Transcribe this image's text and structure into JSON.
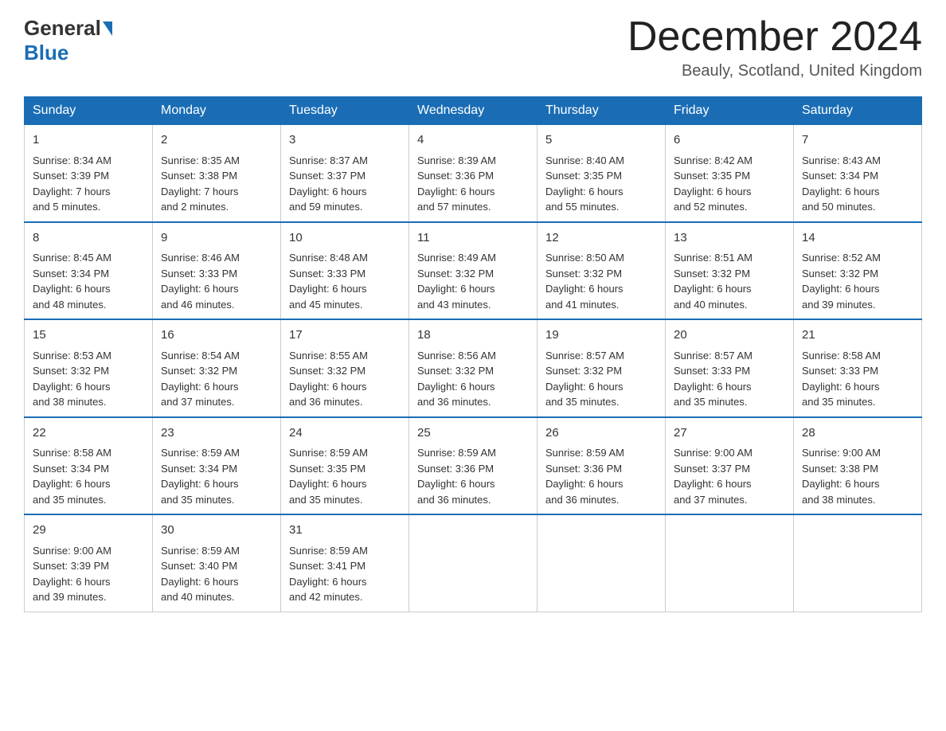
{
  "header": {
    "logo_general": "General",
    "logo_blue": "Blue",
    "month_title": "December 2024",
    "subtitle": "Beauly, Scotland, United Kingdom"
  },
  "days_of_week": [
    "Sunday",
    "Monday",
    "Tuesday",
    "Wednesday",
    "Thursday",
    "Friday",
    "Saturday"
  ],
  "weeks": [
    [
      {
        "day": "1",
        "sunrise": "8:34 AM",
        "sunset": "3:39 PM",
        "daylight": "7 hours and 5 minutes."
      },
      {
        "day": "2",
        "sunrise": "8:35 AM",
        "sunset": "3:38 PM",
        "daylight": "7 hours and 2 minutes."
      },
      {
        "day": "3",
        "sunrise": "8:37 AM",
        "sunset": "3:37 PM",
        "daylight": "6 hours and 59 minutes."
      },
      {
        "day": "4",
        "sunrise": "8:39 AM",
        "sunset": "3:36 PM",
        "daylight": "6 hours and 57 minutes."
      },
      {
        "day": "5",
        "sunrise": "8:40 AM",
        "sunset": "3:35 PM",
        "daylight": "6 hours and 55 minutes."
      },
      {
        "day": "6",
        "sunrise": "8:42 AM",
        "sunset": "3:35 PM",
        "daylight": "6 hours and 52 minutes."
      },
      {
        "day": "7",
        "sunrise": "8:43 AM",
        "sunset": "3:34 PM",
        "daylight": "6 hours and 50 minutes."
      }
    ],
    [
      {
        "day": "8",
        "sunrise": "8:45 AM",
        "sunset": "3:34 PM",
        "daylight": "6 hours and 48 minutes."
      },
      {
        "day": "9",
        "sunrise": "8:46 AM",
        "sunset": "3:33 PM",
        "daylight": "6 hours and 46 minutes."
      },
      {
        "day": "10",
        "sunrise": "8:48 AM",
        "sunset": "3:33 PM",
        "daylight": "6 hours and 45 minutes."
      },
      {
        "day": "11",
        "sunrise": "8:49 AM",
        "sunset": "3:32 PM",
        "daylight": "6 hours and 43 minutes."
      },
      {
        "day": "12",
        "sunrise": "8:50 AM",
        "sunset": "3:32 PM",
        "daylight": "6 hours and 41 minutes."
      },
      {
        "day": "13",
        "sunrise": "8:51 AM",
        "sunset": "3:32 PM",
        "daylight": "6 hours and 40 minutes."
      },
      {
        "day": "14",
        "sunrise": "8:52 AM",
        "sunset": "3:32 PM",
        "daylight": "6 hours and 39 minutes."
      }
    ],
    [
      {
        "day": "15",
        "sunrise": "8:53 AM",
        "sunset": "3:32 PM",
        "daylight": "6 hours and 38 minutes."
      },
      {
        "day": "16",
        "sunrise": "8:54 AM",
        "sunset": "3:32 PM",
        "daylight": "6 hours and 37 minutes."
      },
      {
        "day": "17",
        "sunrise": "8:55 AM",
        "sunset": "3:32 PM",
        "daylight": "6 hours and 36 minutes."
      },
      {
        "day": "18",
        "sunrise": "8:56 AM",
        "sunset": "3:32 PM",
        "daylight": "6 hours and 36 minutes."
      },
      {
        "day": "19",
        "sunrise": "8:57 AM",
        "sunset": "3:32 PM",
        "daylight": "6 hours and 35 minutes."
      },
      {
        "day": "20",
        "sunrise": "8:57 AM",
        "sunset": "3:33 PM",
        "daylight": "6 hours and 35 minutes."
      },
      {
        "day": "21",
        "sunrise": "8:58 AM",
        "sunset": "3:33 PM",
        "daylight": "6 hours and 35 minutes."
      }
    ],
    [
      {
        "day": "22",
        "sunrise": "8:58 AM",
        "sunset": "3:34 PM",
        "daylight": "6 hours and 35 minutes."
      },
      {
        "day": "23",
        "sunrise": "8:59 AM",
        "sunset": "3:34 PM",
        "daylight": "6 hours and 35 minutes."
      },
      {
        "day": "24",
        "sunrise": "8:59 AM",
        "sunset": "3:35 PM",
        "daylight": "6 hours and 35 minutes."
      },
      {
        "day": "25",
        "sunrise": "8:59 AM",
        "sunset": "3:36 PM",
        "daylight": "6 hours and 36 minutes."
      },
      {
        "day": "26",
        "sunrise": "8:59 AM",
        "sunset": "3:36 PM",
        "daylight": "6 hours and 36 minutes."
      },
      {
        "day": "27",
        "sunrise": "9:00 AM",
        "sunset": "3:37 PM",
        "daylight": "6 hours and 37 minutes."
      },
      {
        "day": "28",
        "sunrise": "9:00 AM",
        "sunset": "3:38 PM",
        "daylight": "6 hours and 38 minutes."
      }
    ],
    [
      {
        "day": "29",
        "sunrise": "9:00 AM",
        "sunset": "3:39 PM",
        "daylight": "6 hours and 39 minutes."
      },
      {
        "day": "30",
        "sunrise": "8:59 AM",
        "sunset": "3:40 PM",
        "daylight": "6 hours and 40 minutes."
      },
      {
        "day": "31",
        "sunrise": "8:59 AM",
        "sunset": "3:41 PM",
        "daylight": "6 hours and 42 minutes."
      },
      null,
      null,
      null,
      null
    ]
  ]
}
